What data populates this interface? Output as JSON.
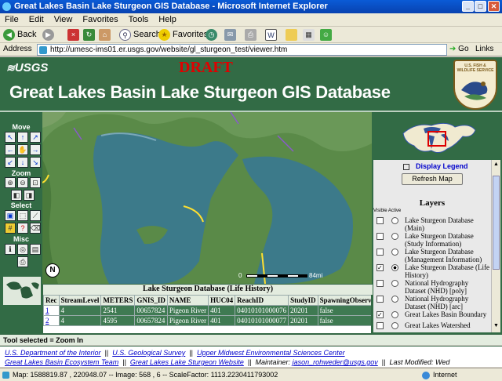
{
  "window": {
    "title": "Great Lakes Basin Lake Sturgeon GIS Database - Microsoft Internet Explorer"
  },
  "menu": [
    "File",
    "Edit",
    "View",
    "Favorites",
    "Tools",
    "Help"
  ],
  "toolbar": {
    "back": "Back",
    "search": "Search",
    "favorites": "Favorites"
  },
  "address": {
    "label": "Address",
    "url": "http://umesc-ims01.er.usgs.gov/website/gl_sturgeon_test/viewer.htm",
    "go": "Go",
    "links": "Links"
  },
  "header": {
    "logo": "USGS",
    "draft": "DRAFT",
    "title": "Great Lakes Basin Lake Sturgeon GIS Database",
    "emblem_top": "U.S. FISH & WILDLIFE SERVICE"
  },
  "tools": {
    "move": "Move",
    "zoom": "Zoom",
    "select": "Select",
    "misc": "Misc"
  },
  "map": {
    "scale_label": "0",
    "scale_end": "84mi",
    "north": "N"
  },
  "legend": {
    "display_legend": "Display Legend",
    "refresh": "Refresh Map",
    "layers_title": "Layers",
    "visible_active": "Visible Active",
    "layers": [
      {
        "label": "Lake Sturgeon Database (Main)",
        "checked": false,
        "active": false
      },
      {
        "label": "Lake Sturgeon Database (Study Information)",
        "checked": false,
        "active": false
      },
      {
        "label": "Lake Sturgeon Database (Management Information)",
        "checked": false,
        "active": false
      },
      {
        "label": "Lake Sturgeon Database (Life History)",
        "checked": true,
        "active": true
      },
      {
        "label": "National Hydrography Dataset (NHD) [poly]",
        "checked": false,
        "active": false
      },
      {
        "label": "National Hydrography Dataset (NHD) [arc]",
        "checked": false,
        "active": false
      },
      {
        "label": "Great Lakes Basin Boundary",
        "checked": true,
        "active": false
      },
      {
        "label": "Great Lakes Watershed",
        "checked": false,
        "active": false
      }
    ]
  },
  "table": {
    "title": "Lake Sturgeon Database (Life History)",
    "headers": [
      "Rec",
      "StreamLevel",
      "METERS",
      "GNIS_ID",
      "NAME",
      "HUC04",
      "ReachID",
      "StudyID",
      "SpawningObserve"
    ],
    "rows": [
      [
        "1",
        "4",
        "2541",
        "00657824",
        "Pigeon River",
        "401",
        "04010101000076",
        "20201",
        "false"
      ],
      [
        "2",
        "4",
        "4595",
        "00657824",
        "Pigeon River",
        "401",
        "04010101000077",
        "20201",
        "false"
      ]
    ]
  },
  "tool_selected": "Tool selected = Zoom In",
  "footer": {
    "links1": [
      "U.S. Department of the Interior",
      "U.S. Geological Survey",
      "Upper Midwest Environmental Sciences Center"
    ],
    "links2": [
      "Great Lakes Basin Ecosystem Team",
      "Great Lakes Lake Sturgeon Website"
    ],
    "maintainer_label": "Maintainer:",
    "maintainer": "jason_rohweder@usgs.gov",
    "modified": "Last Modified: Wed"
  },
  "status": {
    "text": "Map: 1588819.87 , 220948.07 -- Image: 568 , 6 -- ScaleFactor: 1113.2230411793002",
    "zone": "Internet"
  }
}
